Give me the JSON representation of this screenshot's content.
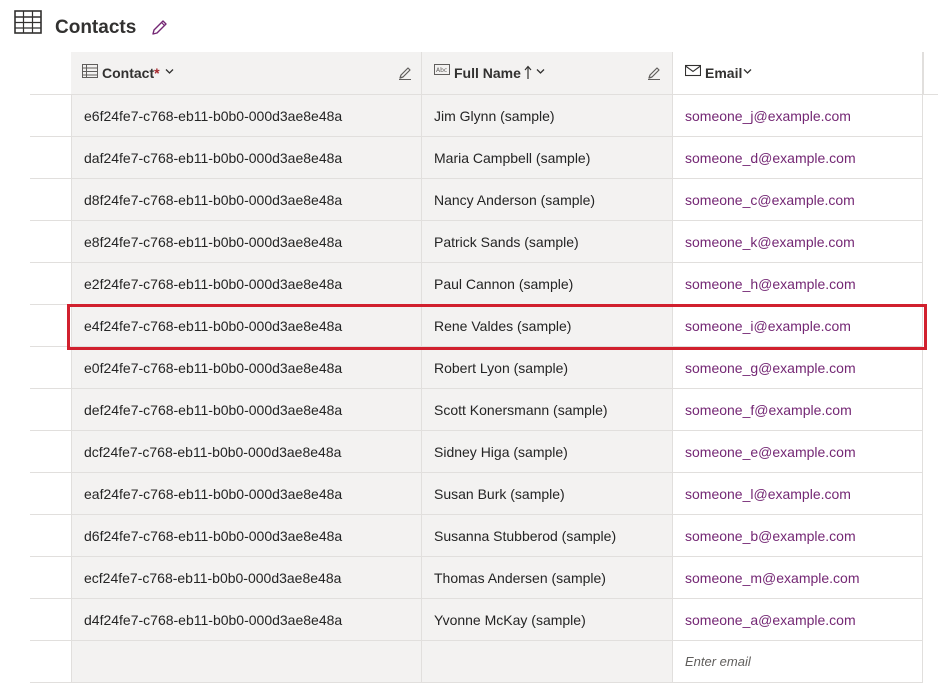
{
  "header": {
    "title": "Contacts"
  },
  "colors": {
    "accent": "#742774",
    "highlight": "#d1202e",
    "required": "#a4262c"
  },
  "columns": {
    "contact": {
      "label": "Contact",
      "required_mark": "*",
      "icon": "primary-key-grid-icon"
    },
    "fullname": {
      "label": "Full Name",
      "icon": "text-abc-icon",
      "sort": "ascending"
    },
    "email": {
      "label": "Email",
      "icon": "mail-icon"
    }
  },
  "rows": [
    {
      "contact": "e6f24fe7-c768-eb11-b0b0-000d3ae8e48a",
      "fullname": "Jim Glynn (sample)",
      "email": "someone_j@example.com"
    },
    {
      "contact": "daf24fe7-c768-eb11-b0b0-000d3ae8e48a",
      "fullname": "Maria Campbell (sample)",
      "email": "someone_d@example.com"
    },
    {
      "contact": "d8f24fe7-c768-eb11-b0b0-000d3ae8e48a",
      "fullname": "Nancy Anderson (sample)",
      "email": "someone_c@example.com"
    },
    {
      "contact": "e8f24fe7-c768-eb11-b0b0-000d3ae8e48a",
      "fullname": "Patrick Sands (sample)",
      "email": "someone_k@example.com"
    },
    {
      "contact": "e2f24fe7-c768-eb11-b0b0-000d3ae8e48a",
      "fullname": "Paul Cannon (sample)",
      "email": "someone_h@example.com"
    },
    {
      "contact": "e4f24fe7-c768-eb11-b0b0-000d3ae8e48a",
      "fullname": "Rene Valdes (sample)",
      "email": "someone_i@example.com"
    },
    {
      "contact": "e0f24fe7-c768-eb11-b0b0-000d3ae8e48a",
      "fullname": "Robert Lyon (sample)",
      "email": "someone_g@example.com"
    },
    {
      "contact": "def24fe7-c768-eb11-b0b0-000d3ae8e48a",
      "fullname": "Scott Konersmann (sample)",
      "email": "someone_f@example.com"
    },
    {
      "contact": "dcf24fe7-c768-eb11-b0b0-000d3ae8e48a",
      "fullname": "Sidney Higa (sample)",
      "email": "someone_e@example.com"
    },
    {
      "contact": "eaf24fe7-c768-eb11-b0b0-000d3ae8e48a",
      "fullname": "Susan Burk (sample)",
      "email": "someone_l@example.com"
    },
    {
      "contact": "d6f24fe7-c768-eb11-b0b0-000d3ae8e48a",
      "fullname": "Susanna Stubberod (sample)",
      "email": "someone_b@example.com"
    },
    {
      "contact": "ecf24fe7-c768-eb11-b0b0-000d3ae8e48a",
      "fullname": "Thomas Andersen (sample)",
      "email": "someone_m@example.com"
    },
    {
      "contact": "d4f24fe7-c768-eb11-b0b0-000d3ae8e48a",
      "fullname": "Yvonne McKay (sample)",
      "email": "someone_a@example.com"
    }
  ],
  "new_row": {
    "email_placeholder": "Enter email"
  },
  "highlighted_row": 5
}
